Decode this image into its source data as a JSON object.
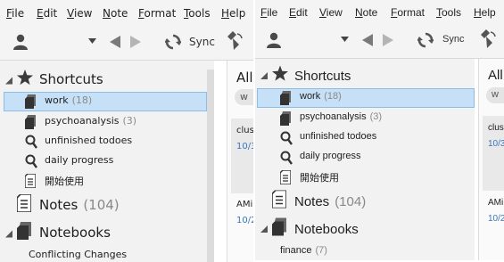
{
  "menus": [
    {
      "mnemonic": "F",
      "rest": "ile"
    },
    {
      "mnemonic": "E",
      "rest": "dit"
    },
    {
      "mnemonic": "V",
      "rest": "iew"
    },
    {
      "mnemonic": "N",
      "rest": "ote"
    },
    {
      "mnemonic": "F",
      "rest": "ormat"
    },
    {
      "mnemonic": "T",
      "rest": "ools"
    },
    {
      "mnemonic": "H",
      "rest": "elp"
    }
  ],
  "toolbar": {
    "sync_label": "Sync"
  },
  "shortcuts": {
    "heading": "Shortcuts",
    "items": [
      {
        "label": "work",
        "count": "(18)"
      },
      {
        "label": "psychoanalysis",
        "count": "(3)"
      },
      {
        "label": "unfinished todoes",
        "count": ""
      },
      {
        "label": "daily progress",
        "count": ""
      },
      {
        "label": "開始使用",
        "count": ""
      }
    ]
  },
  "notes": {
    "heading": "Notes",
    "count": "(104)"
  },
  "notebooks": {
    "heading": "Notebooks"
  },
  "paneA_notebook_item": {
    "label": "Conflicting Changes"
  },
  "paneB_notebook_item": {
    "label": "finance",
    "count": "(7)"
  },
  "list": {
    "title": "All",
    "chip": "w",
    "card1_title": "clus",
    "card1_date": "10/3",
    "card2_title": "AMi",
    "card2_date": "10/2"
  },
  "colors": {
    "selection": "#c6e0f7",
    "selection_border": "#8bbde6",
    "date_blue": "#3b76b8"
  }
}
